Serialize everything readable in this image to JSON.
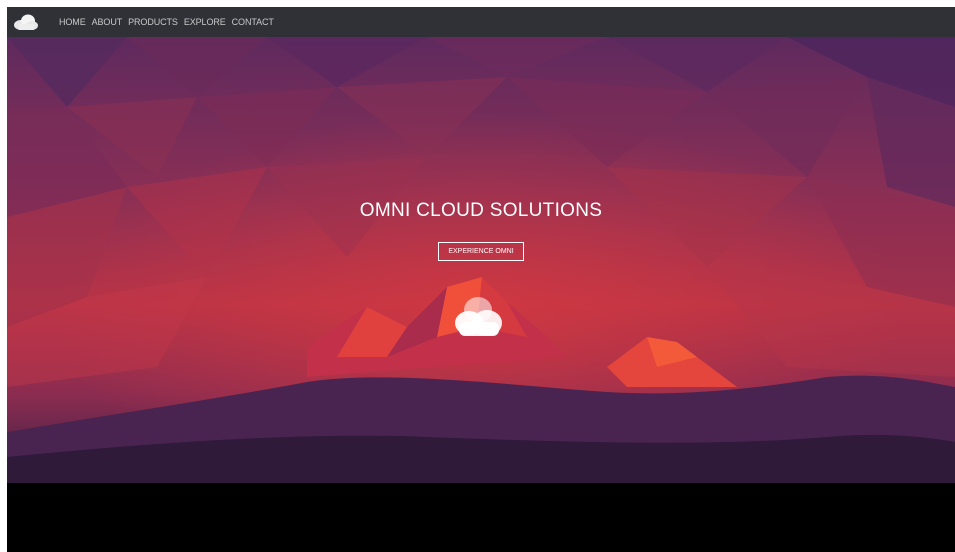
{
  "nav": {
    "logo": "cloud-logo",
    "items": [
      {
        "label": "HOME"
      },
      {
        "label": "ABOUT"
      },
      {
        "label": "PRODUCTS"
      },
      {
        "label": "EXPLORE"
      },
      {
        "label": "CONTACT"
      }
    ]
  },
  "hero": {
    "title": "OMNI CLOUD SOLUTIONS",
    "cta_label": "EXPERIENCE OMNI",
    "center_icon": "cloud-icon"
  },
  "colors": {
    "navbar": "#2f3136",
    "nav_text": "#c9c9cc",
    "hero_base": "#6c2d5c",
    "accent_red": "#d13a45",
    "footer": "#000000"
  }
}
